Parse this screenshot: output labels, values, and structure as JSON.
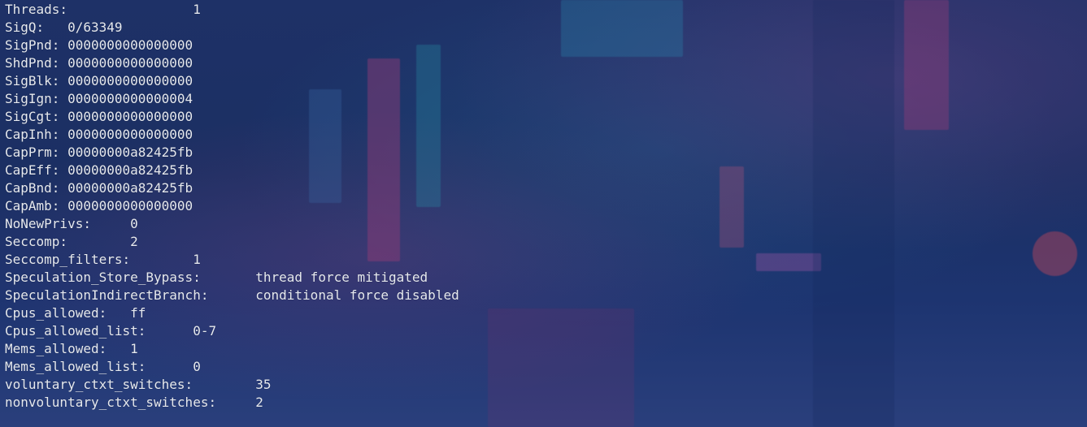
{
  "terminal": {
    "rows": [
      {
        "key": "Threads:",
        "value": "1"
      },
      {
        "key": "SigQ:",
        "value": "0/63349"
      },
      {
        "key": "SigPnd:",
        "value": "0000000000000000"
      },
      {
        "key": "ShdPnd:",
        "value": "0000000000000000"
      },
      {
        "key": "SigBlk:",
        "value": "0000000000000000"
      },
      {
        "key": "SigIgn:",
        "value": "0000000000000004"
      },
      {
        "key": "SigCgt:",
        "value": "0000000000000000"
      },
      {
        "key": "CapInh:",
        "value": "0000000000000000"
      },
      {
        "key": "CapPrm:",
        "value": "00000000a82425fb"
      },
      {
        "key": "CapEff:",
        "value": "00000000a82425fb"
      },
      {
        "key": "CapBnd:",
        "value": "00000000a82425fb"
      },
      {
        "key": "CapAmb:",
        "value": "0000000000000000"
      },
      {
        "key": "NoNewPrivs:",
        "value": "0"
      },
      {
        "key": "Seccomp:",
        "value": "2"
      },
      {
        "key": "Seccomp_filters:",
        "value": "1"
      },
      {
        "key": "Speculation_Store_Bypass:",
        "value": "thread force mitigated"
      },
      {
        "key": "SpeculationIndirectBranch:",
        "value": "conditional force disabled"
      },
      {
        "key": "Cpus_allowed:",
        "value": "ff"
      },
      {
        "key": "Cpus_allowed_list:",
        "value": "0-7"
      },
      {
        "key": "Mems_allowed:",
        "value": "1"
      },
      {
        "key": "Mems_allowed_list:",
        "value": "0"
      },
      {
        "key": "voluntary_ctxt_switches:",
        "value": "35"
      },
      {
        "key": "nonvoluntary_ctxt_switches:",
        "value": "2"
      }
    ]
  },
  "colors": {
    "text": "#e6e9ef",
    "background": "#1d3168"
  }
}
